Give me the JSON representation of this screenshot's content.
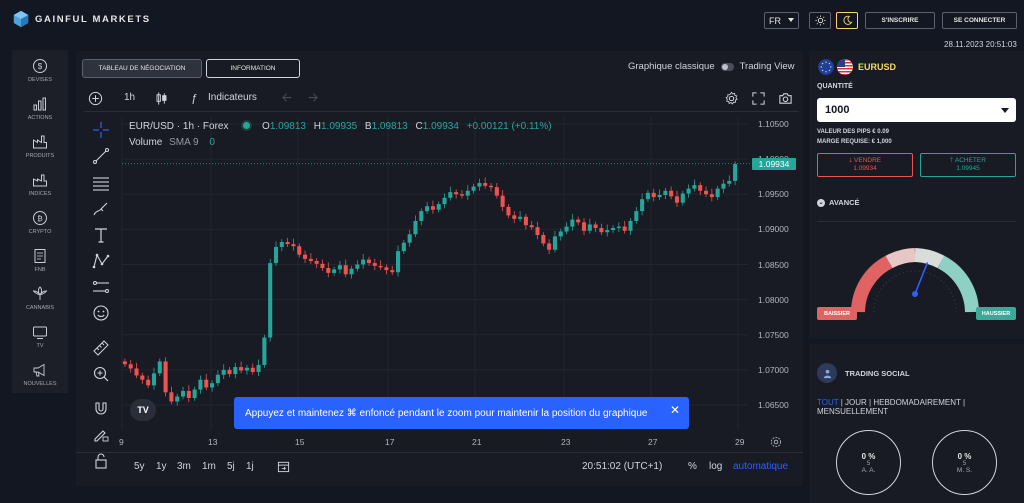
{
  "brand": {
    "name": "GAINFUL MARKETS"
  },
  "header": {
    "language": "FR",
    "signup_label": "S'INSCRIRE",
    "login_label": "SE CONNECTER",
    "datetime": "28.11.2023 20:51:03"
  },
  "sidebar": {
    "items": [
      {
        "label": "DEVISES",
        "icon": "dollar-coin-icon"
      },
      {
        "label": "ACTIONS",
        "icon": "bar-chart-icon"
      },
      {
        "label": "PRODUITS",
        "icon": "factory-icon"
      },
      {
        "label": "INDICES",
        "icon": "factory-icon"
      },
      {
        "label": "CRYPTO",
        "icon": "bitcoin-coin-icon"
      },
      {
        "label": "FNB",
        "icon": "document-icon"
      },
      {
        "label": "CANNABIS",
        "icon": "leaf-icon"
      },
      {
        "label": "TV",
        "icon": "tv-icon"
      },
      {
        "label": "NOUVELLES",
        "icon": "megaphone-icon"
      }
    ]
  },
  "tabs": {
    "trading_table": "TABLEAU DE NÉGOCIATION",
    "information": "INFORMATION"
  },
  "chart_toggle": {
    "classic": "Graphique classique",
    "tradingview": "Trading View"
  },
  "toolbar": {
    "interval": "1h",
    "indicators": "Indicateurs"
  },
  "chart_legend": {
    "symbol": "EUR/USD · 1h · Forex",
    "o_label": "O",
    "o": "1.09813",
    "h_label": "H",
    "h": "1.09935",
    "b_label": "B",
    "b": "1.09813",
    "c_label": "C",
    "c": "1.09934",
    "change": "+0.00121 (+0.11%)",
    "volume": "Volume",
    "sma": "SMA 9",
    "sma_value": "0"
  },
  "chart_data": {
    "type": "candlestick",
    "symbol": "EUR/USD",
    "interval": "1h",
    "current_price": "1.09934",
    "y_ticks": [
      "1.10500",
      "1.10000",
      "1.09500",
      "1.09000",
      "1.08500",
      "1.08000",
      "1.07500",
      "1.07000",
      "1.06500"
    ],
    "x_ticks": [
      "9",
      "13",
      "15",
      "17",
      "21",
      "23",
      "27",
      "29"
    ],
    "ylim": [
      1.064,
      1.106
    ],
    "close": [
      1.0708,
      1.0702,
      1.0692,
      1.0686,
      1.0678,
      1.0695,
      1.0712,
      1.0668,
      1.0655,
      1.0662,
      1.067,
      1.066,
      1.0672,
      1.0686,
      1.0675,
      1.0681,
      1.0693,
      1.07,
      1.0694,
      1.0704,
      1.0699,
      1.0703,
      1.0697,
      1.0707,
      1.0746,
      1.0852,
      1.0875,
      1.0882,
      1.0879,
      1.0876,
      1.0864,
      1.0858,
      1.0855,
      1.0851,
      1.0845,
      1.0838,
      1.0843,
      1.0849,
      1.0836,
      1.0844,
      1.085,
      1.0857,
      1.0852,
      1.0848,
      1.0846,
      1.0842,
      1.0839,
      1.0869,
      1.0881,
      1.0893,
      1.0912,
      1.0926,
      1.0933,
      1.0928,
      1.0936,
      1.0945,
      1.0953,
      1.095,
      1.0948,
      1.0955,
      1.0961,
      1.0966,
      1.0962,
      1.096,
      1.0948,
      1.0932,
      1.092,
      1.0915,
      1.0918,
      1.0906,
      1.0903,
      1.0892,
      1.088,
      1.0871,
      1.089,
      1.0897,
      1.0904,
      1.0914,
      1.091,
      1.0898,
      1.0907,
      1.0902,
      1.0896,
      1.0899,
      1.0902,
      1.0904,
      1.0898,
      1.0912,
      1.0926,
      1.0943,
      1.0952,
      1.0946,
      1.0949,
      1.0955,
      1.0947,
      1.0938,
      1.0951,
      1.0958,
      1.0963,
      1.0955,
      1.095,
      1.0946,
      1.0958,
      1.0965,
      1.0969,
      1.0993
    ]
  },
  "toast": {
    "message": "Appuyez et maintenez ⌘ enfoncé pendant le zoom pour maintenir la position du graphique",
    "close": "✕"
  },
  "bottom_bar": {
    "ranges": [
      "5y",
      "1y",
      "3m",
      "1m",
      "5j",
      "1j"
    ],
    "time": "20:51:02 (UTC+1)",
    "percent": "%",
    "log": "log",
    "auto": "automatique"
  },
  "trade_panel": {
    "symbol": "EURUSD",
    "quantity_label": "QUANTITÉ",
    "quantity": "1000",
    "pip_value": "VALEUR DES PIPS € 0.09",
    "margin": "MARGE REQUISE: € 1,000",
    "sell_label": "VENDRE",
    "sell_price": "1.09934",
    "buy_label": "ACHETER",
    "buy_price": "1.09945",
    "advanced": "AVANCÉ",
    "bearish": "BAISSIER",
    "bullish": "HAUSSIER",
    "sentiment_bullish_fraction": 0.62
  },
  "social": {
    "title": "TRADING SOCIAL",
    "filters": [
      "TOUT",
      "JOUR",
      "HEBDOMADAIREMENT",
      "MENSUELLEMENT"
    ],
    "sep": "|",
    "stats": [
      {
        "pct": "0 %",
        "n": "5",
        "label": "A. A."
      },
      {
        "pct": "0 %",
        "n": "5",
        "label": "M. S."
      }
    ]
  },
  "colors": {
    "up": "#26a69a",
    "down": "#ef5350",
    "accent": "#2962ff",
    "gold": "#f5d76e"
  }
}
